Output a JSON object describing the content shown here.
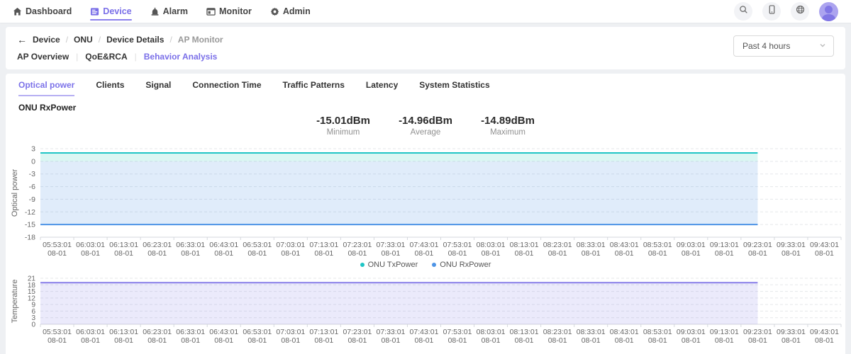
{
  "ui": {
    "accent": "#7a6fe8"
  },
  "nav": {
    "items": [
      {
        "label": "Dashboard",
        "icon": "home-icon"
      },
      {
        "label": "Device",
        "icon": "device-icon",
        "active": true
      },
      {
        "label": "Alarm",
        "icon": "alarm-icon"
      },
      {
        "label": "Monitor",
        "icon": "monitor-icon"
      },
      {
        "label": "Admin",
        "icon": "gear-icon"
      }
    ]
  },
  "breadcrumb": {
    "back": "Device",
    "items": [
      "ONU",
      "Device Details",
      "AP Monitor"
    ]
  },
  "subnav": {
    "items": [
      "AP Overview",
      "QoE&RCA",
      "Behavior Analysis"
    ],
    "active": "Behavior Analysis"
  },
  "time_range": {
    "value": "Past 4 hours"
  },
  "tabs": {
    "items": [
      "Optical power",
      "Clients",
      "Signal",
      "Connection Time",
      "Traffic Patterns",
      "Latency",
      "System Statistics"
    ],
    "active": "Optical power"
  },
  "section_title": "ONU RxPower",
  "stats": [
    {
      "value": "-15.01dBm",
      "label": "Minimum"
    },
    {
      "value": "-14.96dBm",
      "label": "Average"
    },
    {
      "value": "-14.89dBm",
      "label": "Maximum"
    }
  ],
  "chart_data": [
    {
      "type": "area",
      "ylabel": "Optical power",
      "ylim": [
        -18,
        3
      ],
      "yticks": [
        3,
        0,
        -3,
        -6,
        -9,
        -12,
        -15,
        -18
      ],
      "baseline": 0,
      "grid": "dashed",
      "x_date": "08-01",
      "x_times": [
        "05:53:01",
        "06:03:01",
        "06:13:01",
        "06:23:01",
        "06:33:01",
        "06:43:01",
        "06:53:01",
        "07:03:01",
        "07:13:01",
        "07:23:01",
        "07:33:01",
        "07:43:01",
        "07:53:01",
        "08:03:01",
        "08:13:01",
        "08:23:01",
        "08:33:01",
        "08:43:01",
        "08:53:01",
        "09:03:01",
        "09:13:01",
        "09:23:01",
        "09:33:01",
        "09:43:01"
      ],
      "series": [
        {
          "name": "ONU TxPower",
          "color": "#1fc5c5",
          "fill": "rgba(32,198,183,0.16)",
          "value": 2,
          "x_start": "05:53:01",
          "x_end": "09:23:01"
        },
        {
          "name": "ONU RxPower",
          "color": "#4e94e6",
          "fill": "rgba(84,150,230,0.18)",
          "value": -15,
          "x_start": "05:53:01",
          "x_end": "09:23:01"
        }
      ],
      "legend": [
        "ONU TxPower",
        "ONU RxPower"
      ],
      "legend_position": "bottom"
    },
    {
      "type": "area",
      "ylabel": "Temperature",
      "ylim": [
        0,
        21
      ],
      "yticks": [
        21,
        18,
        15,
        12,
        9,
        6,
        3,
        0
      ],
      "baseline": 0,
      "grid": "dashed",
      "x_date": "08-01",
      "x_times": [
        "05:53:01",
        "06:03:01",
        "06:13:01",
        "06:23:01",
        "06:33:01",
        "06:43:01",
        "06:53:01",
        "07:03:01",
        "07:13:01",
        "07:23:01",
        "07:33:01",
        "07:43:01",
        "07:53:01",
        "08:03:01",
        "08:13:01",
        "08:23:01",
        "08:33:01",
        "08:43:01",
        "08:53:01",
        "09:03:01",
        "09:13:01",
        "09:23:01",
        "09:33:01",
        "09:43:01"
      ],
      "series": [
        {
          "name": "Temperature",
          "color": "#877de9",
          "fill": "rgba(133,123,232,0.16)",
          "value": 19,
          "x_start": "05:53:01",
          "x_end": "09:23:01"
        }
      ]
    }
  ]
}
